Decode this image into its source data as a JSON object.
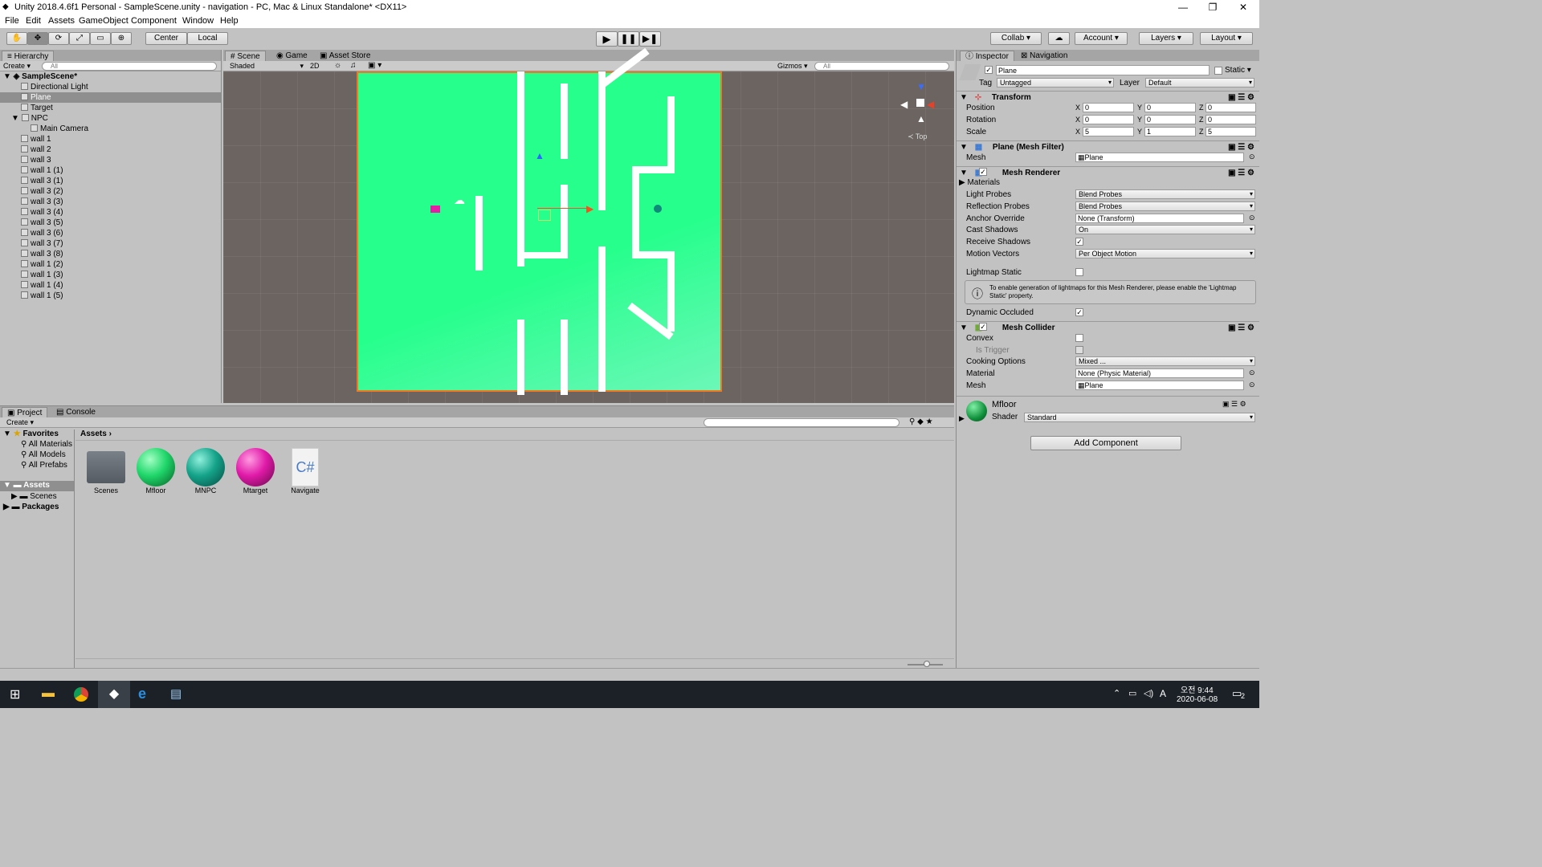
{
  "titlebar": {
    "title": "Unity 2018.4.6f1 Personal - SampleScene.unity - navigation - PC, Mac & Linux Standalone* <DX11>"
  },
  "menu": [
    "File",
    "Edit",
    "Assets",
    "GameObject",
    "Component",
    "Window",
    "Help"
  ],
  "toolbar": {
    "center": "Center",
    "local": "Local",
    "collab": "Collab ▾",
    "account": "Account",
    "layers": "Layers",
    "layout": "Layout"
  },
  "hierarchy": {
    "tab": "Hierarchy",
    "create": "Create",
    "search_placeholder": "All",
    "scene": "SampleScene*",
    "items": [
      "Directional Light",
      "Plane",
      "Target",
      "NPC",
      "Main Camera",
      "wall 1",
      "wall 2",
      "wall 3",
      "wall 1 (1)",
      "wall 3 (1)",
      "wall 3 (2)",
      "wall 3 (3)",
      "wall 3 (4)",
      "wall 3 (5)",
      "wall 3 (6)",
      "wall 3 (7)",
      "wall 3 (8)",
      "wall 1 (2)",
      "wall 1 (3)",
      "wall 1 (4)",
      "wall 1 (5)"
    ]
  },
  "scene": {
    "tabs": [
      "Scene",
      "Game",
      "Asset Store"
    ],
    "shading": "Shaded",
    "mode2d": "2D",
    "gizmos": "Gizmos",
    "search_placeholder": "All",
    "view": "Top",
    "colors": {
      "floor": "#26ff8c",
      "wall": "#ffffff"
    }
  },
  "inspector": {
    "tabs": [
      "Inspector",
      "Navigation"
    ],
    "object_name": "Plane",
    "static": "Static",
    "tag_label": "Tag",
    "tag": "Untagged",
    "layer_label": "Layer",
    "layer": "Default",
    "transform": {
      "title": "Transform",
      "rows": [
        {
          "label": "Position",
          "x": "0",
          "y": "0",
          "z": "0"
        },
        {
          "label": "Rotation",
          "x": "0",
          "y": "0",
          "z": "0"
        },
        {
          "label": "Scale",
          "x": "5",
          "y": "1",
          "z": "5"
        }
      ]
    },
    "mesh_filter": {
      "title": "Plane (Mesh Filter)",
      "mesh_label": "Mesh",
      "mesh": "Plane"
    },
    "mesh_renderer": {
      "title": "Mesh Renderer",
      "materials": "Materials",
      "light_probes_label": "Light Probes",
      "light_probes": "Blend Probes",
      "reflection_label": "Reflection Probes",
      "reflection": "Blend Probes",
      "anchor_label": "Anchor Override",
      "anchor": "None (Transform)",
      "cast_label": "Cast Shadows",
      "cast": "On",
      "receive_label": "Receive Shadows",
      "motion_label": "Motion Vectors",
      "motion": "Per Object Motion",
      "lightmap_label": "Lightmap Static",
      "info": "To enable generation of lightmaps for this Mesh Renderer, please enable the 'Lightmap Static' property.",
      "dynamic_label": "Dynamic Occluded"
    },
    "mesh_collider": {
      "title": "Mesh Collider",
      "convex": "Convex",
      "trigger": "Is Trigger",
      "cooking_label": "Cooking Options",
      "cooking": "Mixed ...",
      "material_label": "Material",
      "material": "None (Physic Material)",
      "mesh_label": "Mesh",
      "mesh": "Plane"
    },
    "material": {
      "name": "Mfloor",
      "shader_label": "Shader",
      "shader": "Standard"
    },
    "add_component": "Add Component"
  },
  "project": {
    "tabs": [
      "Project",
      "Console"
    ],
    "create": "Create",
    "favorites": "Favorites",
    "fav_items": [
      "All Materials",
      "All Models",
      "All Prefabs"
    ],
    "assets_root": "Assets",
    "tree": [
      "Scenes"
    ],
    "packages": "Packages",
    "breadcrumb": "Assets",
    "assets": [
      {
        "name": "Scenes"
      },
      {
        "name": "Mfloor",
        "color": "#1fd66a"
      },
      {
        "name": "MNPC",
        "color": "#14a38a"
      },
      {
        "name": "Mtarget",
        "color": "#e01aa8"
      },
      {
        "name": "Navigate"
      }
    ]
  },
  "taskbar": {
    "time": "오전 9:44",
    "date": "2020-06-08",
    "lang": "A",
    "notif": "2"
  }
}
